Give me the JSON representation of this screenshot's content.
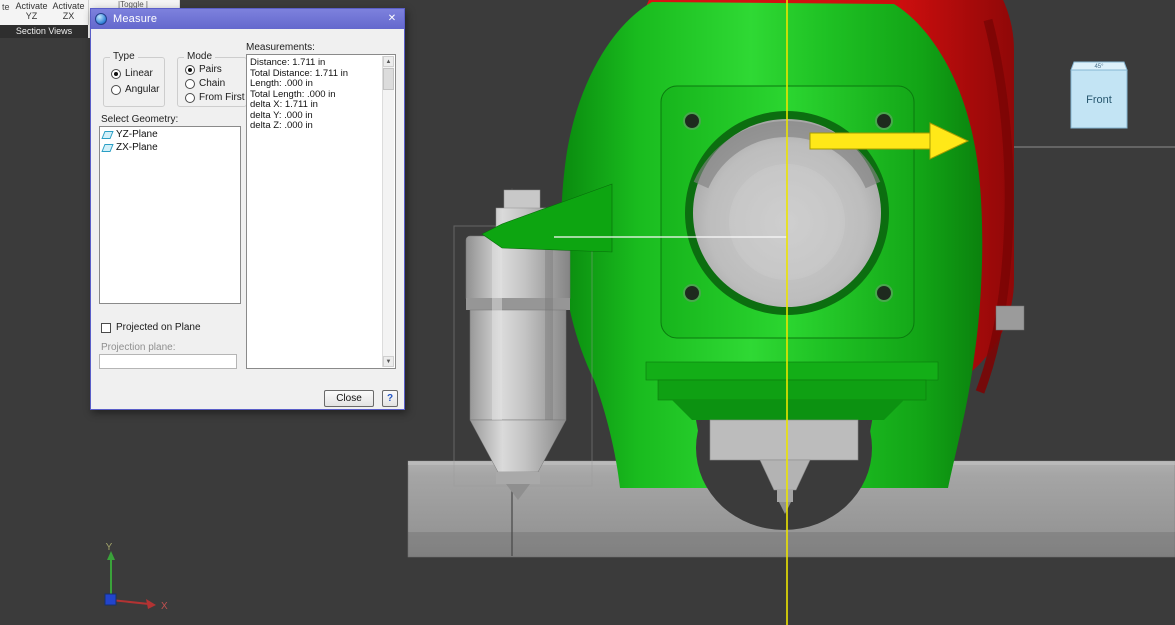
{
  "toolbar": {
    "fragment": "te",
    "activate_yz": "Activate YZ",
    "activate_zx": "Activate ZX",
    "toggle_fragment": "|Toggle |",
    "section_tab": "Section Views"
  },
  "dialog": {
    "title": "Measure",
    "type_group": {
      "label": "Type",
      "options": [
        {
          "label": "Linear",
          "selected": true
        },
        {
          "label": "Angular",
          "selected": false
        }
      ]
    },
    "mode_group": {
      "label": "Mode",
      "options": [
        {
          "label": "Pairs",
          "selected": true
        },
        {
          "label": "Chain",
          "selected": false
        },
        {
          "label": "From First",
          "selected": false
        }
      ]
    },
    "geometry": {
      "label": "Select Geometry:",
      "items": [
        {
          "label": "YZ-Plane"
        },
        {
          "label": "ZX-Plane"
        }
      ]
    },
    "measurements": {
      "label": "Measurements:",
      "lines": [
        "Distance: 1.711 in",
        "Total Distance: 1.711 in",
        "Length: .000 in",
        "Total Length: .000 in",
        "delta X: 1.711 in",
        "delta Y: .000 in",
        "delta Z: .000 in"
      ]
    },
    "projected_on_plane": {
      "label": "Projected on Plane",
      "checked": false
    },
    "projection_plane": {
      "label": "Projection plane:",
      "value": ""
    },
    "buttons": {
      "close": "Close",
      "help": "?"
    }
  },
  "viewport": {
    "view_cube": {
      "label": "Front",
      "top_label": "45°"
    },
    "triad": {
      "x": "X",
      "y": "Y"
    }
  },
  "icons": {
    "close": "✕",
    "scroll_up": "▲",
    "scroll_down": "▼"
  },
  "colors": {
    "titlebar": "#6f73d6",
    "viewport_bg": "#3b3b3b",
    "model_green": "#1fc224",
    "model_red": "#cf1010",
    "axis_yellow": "#ece400",
    "view_cube_blue": "#c3e4f4"
  }
}
